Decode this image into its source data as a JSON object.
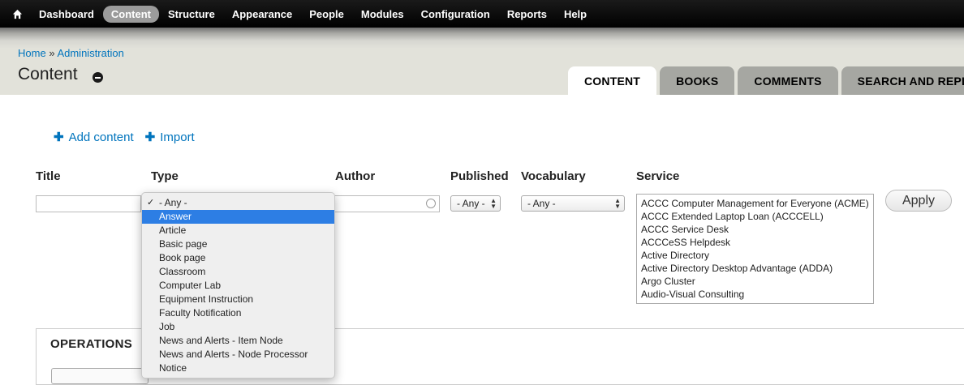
{
  "toolbar": {
    "home_icon": "home-icon",
    "items": [
      {
        "label": "Dashboard",
        "active": false
      },
      {
        "label": "Content",
        "active": true
      },
      {
        "label": "Structure",
        "active": false
      },
      {
        "label": "Appearance",
        "active": false
      },
      {
        "label": "People",
        "active": false
      },
      {
        "label": "Modules",
        "active": false
      },
      {
        "label": "Configuration",
        "active": false
      },
      {
        "label": "Reports",
        "active": false
      },
      {
        "label": "Help",
        "active": false
      }
    ]
  },
  "breadcrumb": {
    "home": "Home",
    "separator": "»",
    "admin": "Administration"
  },
  "page": {
    "title": "Content"
  },
  "tabs": [
    {
      "label": "CONTENT",
      "active": true
    },
    {
      "label": "BOOKS",
      "active": false
    },
    {
      "label": "COMMENTS",
      "active": false
    },
    {
      "label": "SEARCH AND REPLA",
      "active": false
    }
  ],
  "actions": {
    "add_content": "Add content",
    "import": "Import"
  },
  "filters": {
    "title_label": "Title",
    "type_label": "Type",
    "author_label": "Author",
    "published_label": "Published",
    "vocabulary_label": "Vocabulary",
    "service_label": "Service",
    "published_value": "- Any -",
    "vocabulary_value": "- Any -",
    "service_options": [
      "ACCC Computer Management for Everyone (ACME)",
      "ACCC Extended Laptop Loan (ACCCELL)",
      "ACCC Service Desk",
      "ACCCeSS Helpdesk",
      "Active Directory",
      "Active Directory Desktop Advantage (ADDA)",
      "Argo Cluster",
      "Audio-Visual Consulting"
    ],
    "apply_label": "Apply"
  },
  "type_dropdown": {
    "checked": "- Any -",
    "highlighted": "Answer",
    "options": [
      "- Any -",
      "Answer",
      "Article",
      "Basic page",
      "Book page",
      "Classroom",
      "Computer Lab",
      "Equipment Instruction",
      "Faculty Notification",
      "Job",
      "News and Alerts - Item Node",
      "News and Alerts - Node Processor",
      "Notice"
    ]
  },
  "operations": {
    "title": "OPERATIONS"
  },
  "colors": {
    "link": "#0074bd",
    "selected_option": "#2d7ee4",
    "toolbar_bg": "#000000",
    "header_bg": "#e2e2da"
  }
}
